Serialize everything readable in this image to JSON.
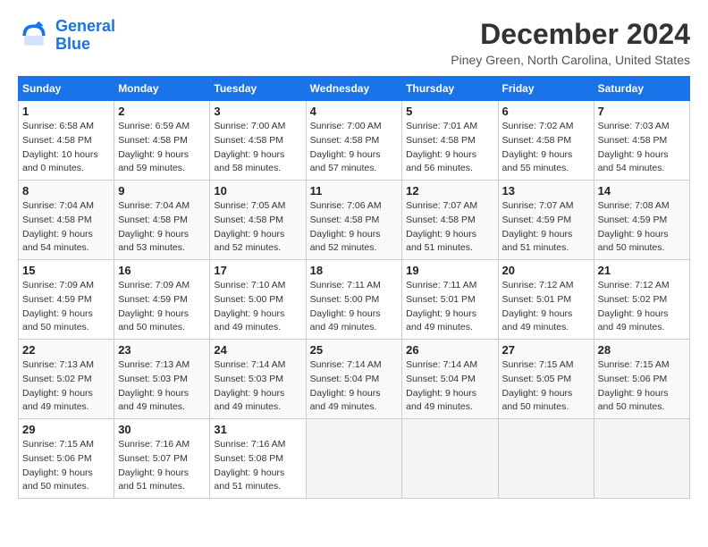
{
  "header": {
    "logo_line1": "General",
    "logo_line2": "Blue",
    "month": "December 2024",
    "location": "Piney Green, North Carolina, United States"
  },
  "weekdays": [
    "Sunday",
    "Monday",
    "Tuesday",
    "Wednesday",
    "Thursday",
    "Friday",
    "Saturday"
  ],
  "weeks": [
    [
      {
        "day": "1",
        "sunrise": "6:58 AM",
        "sunset": "4:58 PM",
        "daylight": "10 hours and 0 minutes."
      },
      {
        "day": "2",
        "sunrise": "6:59 AM",
        "sunset": "4:58 PM",
        "daylight": "9 hours and 59 minutes."
      },
      {
        "day": "3",
        "sunrise": "7:00 AM",
        "sunset": "4:58 PM",
        "daylight": "9 hours and 58 minutes."
      },
      {
        "day": "4",
        "sunrise": "7:00 AM",
        "sunset": "4:58 PM",
        "daylight": "9 hours and 57 minutes."
      },
      {
        "day": "5",
        "sunrise": "7:01 AM",
        "sunset": "4:58 PM",
        "daylight": "9 hours and 56 minutes."
      },
      {
        "day": "6",
        "sunrise": "7:02 AM",
        "sunset": "4:58 PM",
        "daylight": "9 hours and 55 minutes."
      },
      {
        "day": "7",
        "sunrise": "7:03 AM",
        "sunset": "4:58 PM",
        "daylight": "9 hours and 54 minutes."
      }
    ],
    [
      {
        "day": "8",
        "sunrise": "7:04 AM",
        "sunset": "4:58 PM",
        "daylight": "9 hours and 54 minutes."
      },
      {
        "day": "9",
        "sunrise": "7:04 AM",
        "sunset": "4:58 PM",
        "daylight": "9 hours and 53 minutes."
      },
      {
        "day": "10",
        "sunrise": "7:05 AM",
        "sunset": "4:58 PM",
        "daylight": "9 hours and 52 minutes."
      },
      {
        "day": "11",
        "sunrise": "7:06 AM",
        "sunset": "4:58 PM",
        "daylight": "9 hours and 52 minutes."
      },
      {
        "day": "12",
        "sunrise": "7:07 AM",
        "sunset": "4:58 PM",
        "daylight": "9 hours and 51 minutes."
      },
      {
        "day": "13",
        "sunrise": "7:07 AM",
        "sunset": "4:59 PM",
        "daylight": "9 hours and 51 minutes."
      },
      {
        "day": "14",
        "sunrise": "7:08 AM",
        "sunset": "4:59 PM",
        "daylight": "9 hours and 50 minutes."
      }
    ],
    [
      {
        "day": "15",
        "sunrise": "7:09 AM",
        "sunset": "4:59 PM",
        "daylight": "9 hours and 50 minutes."
      },
      {
        "day": "16",
        "sunrise": "7:09 AM",
        "sunset": "4:59 PM",
        "daylight": "9 hours and 50 minutes."
      },
      {
        "day": "17",
        "sunrise": "7:10 AM",
        "sunset": "5:00 PM",
        "daylight": "9 hours and 49 minutes."
      },
      {
        "day": "18",
        "sunrise": "7:11 AM",
        "sunset": "5:00 PM",
        "daylight": "9 hours and 49 minutes."
      },
      {
        "day": "19",
        "sunrise": "7:11 AM",
        "sunset": "5:01 PM",
        "daylight": "9 hours and 49 minutes."
      },
      {
        "day": "20",
        "sunrise": "7:12 AM",
        "sunset": "5:01 PM",
        "daylight": "9 hours and 49 minutes."
      },
      {
        "day": "21",
        "sunrise": "7:12 AM",
        "sunset": "5:02 PM",
        "daylight": "9 hours and 49 minutes."
      }
    ],
    [
      {
        "day": "22",
        "sunrise": "7:13 AM",
        "sunset": "5:02 PM",
        "daylight": "9 hours and 49 minutes."
      },
      {
        "day": "23",
        "sunrise": "7:13 AM",
        "sunset": "5:03 PM",
        "daylight": "9 hours and 49 minutes."
      },
      {
        "day": "24",
        "sunrise": "7:14 AM",
        "sunset": "5:03 PM",
        "daylight": "9 hours and 49 minutes."
      },
      {
        "day": "25",
        "sunrise": "7:14 AM",
        "sunset": "5:04 PM",
        "daylight": "9 hours and 49 minutes."
      },
      {
        "day": "26",
        "sunrise": "7:14 AM",
        "sunset": "5:04 PM",
        "daylight": "9 hours and 49 minutes."
      },
      {
        "day": "27",
        "sunrise": "7:15 AM",
        "sunset": "5:05 PM",
        "daylight": "9 hours and 50 minutes."
      },
      {
        "day": "28",
        "sunrise": "7:15 AM",
        "sunset": "5:06 PM",
        "daylight": "9 hours and 50 minutes."
      }
    ],
    [
      {
        "day": "29",
        "sunrise": "7:15 AM",
        "sunset": "5:06 PM",
        "daylight": "9 hours and 50 minutes."
      },
      {
        "day": "30",
        "sunrise": "7:16 AM",
        "sunset": "5:07 PM",
        "daylight": "9 hours and 51 minutes."
      },
      {
        "day": "31",
        "sunrise": "7:16 AM",
        "sunset": "5:08 PM",
        "daylight": "9 hours and 51 minutes."
      },
      null,
      null,
      null,
      null
    ]
  ],
  "labels": {
    "sunrise": "Sunrise: ",
    "sunset": "Sunset: ",
    "daylight": "Daylight: "
  }
}
